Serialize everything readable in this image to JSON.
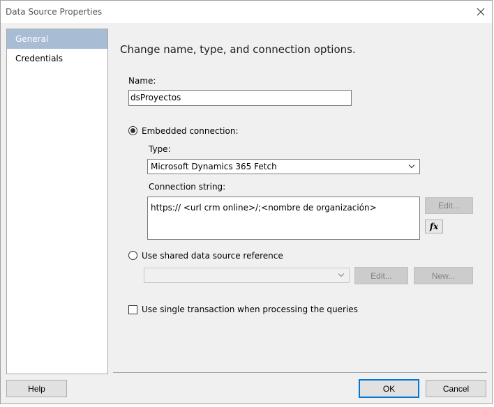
{
  "window": {
    "title": "Data Source Properties"
  },
  "nav": {
    "items": [
      "General",
      "Credentials"
    ]
  },
  "main": {
    "heading": "Change name, type, and connection options.",
    "name_label": "Name:",
    "name_value": "dsProyectos",
    "embedded_label": "Embedded connection:",
    "type_label": "Type:",
    "type_value": "Microsoft Dynamics 365 Fetch",
    "conn_label": "Connection string:",
    "conn_value": "https:// <url crm online>/;<nombre de organización>",
    "edit_label": "Edit...",
    "fx_label": "fx",
    "shared_label": "Use shared data source reference",
    "shared_value": "",
    "shared_edit_label": "Edit...",
    "shared_new_label": "New...",
    "single_tx_label": "Use single transaction when processing the queries"
  },
  "footer": {
    "help": "Help",
    "ok": "OK",
    "cancel": "Cancel"
  },
  "colors": {
    "accent": "#0078d7",
    "nav_selected": "#a8bcd3"
  }
}
